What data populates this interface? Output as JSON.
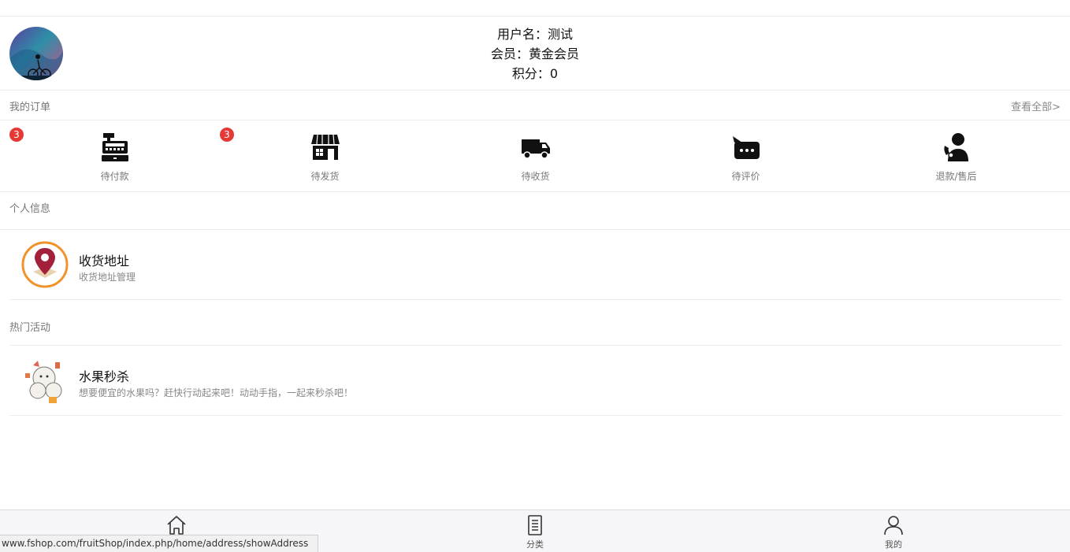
{
  "profile": {
    "username_line": "用户名：测试",
    "member_line": "会员：黄金会员",
    "points_line": "积分：0"
  },
  "orders": {
    "title": "我的订单",
    "view_all": "查看全部>",
    "items": [
      {
        "label": "待付款",
        "badge": "3",
        "icon": "cash-register-icon"
      },
      {
        "label": "待发货",
        "badge": "3",
        "icon": "store-icon"
      },
      {
        "label": "待收货",
        "badge": "",
        "icon": "truck-icon"
      },
      {
        "label": "待评价",
        "badge": "",
        "icon": "comment-icon"
      },
      {
        "label": "退款/售后",
        "badge": "",
        "icon": "customer-service-icon"
      }
    ]
  },
  "personal": {
    "title": "个人信息",
    "address": {
      "title": "收货地址",
      "subtitle": "收货地址管理",
      "icon": "location-pin-icon"
    }
  },
  "activities": {
    "title": "热门活动",
    "flash_sale": {
      "title": "水果秒杀",
      "subtitle": "想要便宜的水果吗？赶快行动起来吧！动动手指，一起来秒杀吧！"
    }
  },
  "tabbar": {
    "home": {
      "label": "",
      "icon": "home-icon"
    },
    "category": {
      "label": "分类",
      "icon": "list-icon"
    },
    "mine": {
      "label": "我的",
      "icon": "user-icon"
    }
  },
  "status_url": "www.fshop.com/fruitShop/index.php/home/address/showAddress",
  "colors": {
    "badge": "#e53935",
    "address_ring": "#f0932b",
    "pin": "#a3203a"
  }
}
